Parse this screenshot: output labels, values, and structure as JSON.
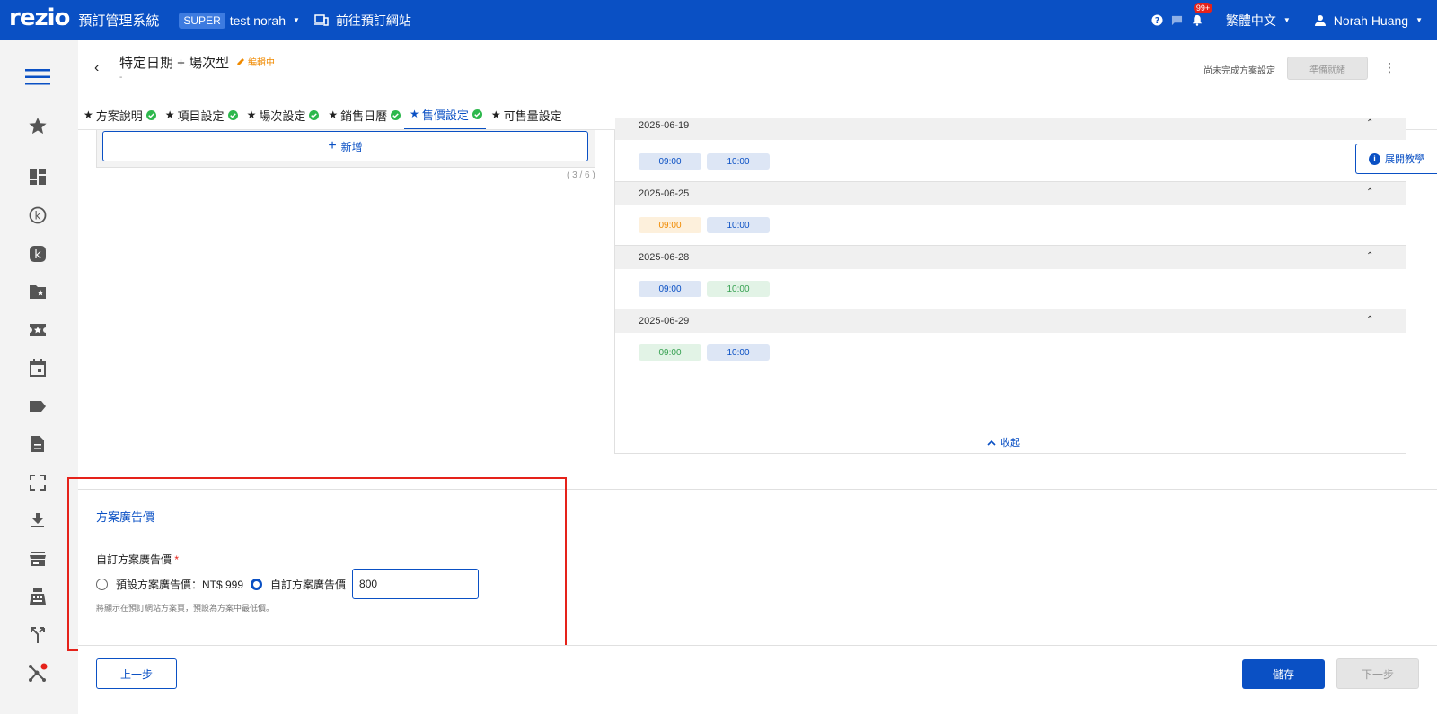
{
  "topbar": {
    "logo": "rezio",
    "system_title": "預訂管理系統",
    "super_badge": "SUPER",
    "account_name": "test norah",
    "goto_site": "前往預訂網站",
    "notification_count": "99+",
    "language": "繁體中文",
    "user_name": "Norah Huang",
    "icons": [
      "help-icon",
      "chat-icon",
      "bell-icon",
      "person-icon"
    ]
  },
  "sidebar": {
    "items": [
      "menu-icon",
      "star-icon",
      "dashboard-icon",
      "k-circle-icon",
      "k-square-icon",
      "folder-star-icon",
      "ticket-icon",
      "calendar-icon",
      "label-icon",
      "document-icon",
      "fullscreen-icon",
      "download-icon",
      "store-icon",
      "cashier-icon",
      "merge-icon",
      "network-icon"
    ]
  },
  "header": {
    "back_icon": "‹",
    "title": "特定日期 + 場次型",
    "editing_status": "編輯中",
    "subtitle": "-",
    "incomplete_text": "尚未完成方案設定",
    "ready_button": "準備就緒",
    "more_icon": "⋮"
  },
  "tabs": [
    {
      "label": "方案說明",
      "done": true
    },
    {
      "label": "項目設定",
      "done": true
    },
    {
      "label": "場次設定",
      "done": true
    },
    {
      "label": "銷售日曆",
      "done": true
    },
    {
      "label": "售價設定",
      "done": true,
      "active": true
    },
    {
      "label": "可售量設定",
      "done": false
    }
  ],
  "left_panel": {
    "add_button": "新增",
    "count": "( 3 / 6 )"
  },
  "schedule": {
    "partial_date": "2025-06-19",
    "dates": [
      {
        "date": "2025-06-19",
        "slots": [
          {
            "time": "09:00",
            "color": "blue"
          },
          {
            "time": "10:00",
            "color": "blue"
          }
        ]
      },
      {
        "date": "2025-06-25",
        "slots": [
          {
            "time": "09:00",
            "color": "orange"
          },
          {
            "time": "10:00",
            "color": "blue"
          }
        ]
      },
      {
        "date": "2025-06-28",
        "slots": [
          {
            "time": "09:00",
            "color": "blue"
          },
          {
            "time": "10:00",
            "color": "green"
          }
        ]
      },
      {
        "date": "2025-06-29",
        "slots": [
          {
            "time": "09:00",
            "color": "green"
          },
          {
            "time": "10:00",
            "color": "blue"
          }
        ]
      }
    ],
    "collapse_label": "收起"
  },
  "tutorial_button": "展開教學",
  "ad_price": {
    "section_title": "方案廣告價",
    "field_label": "自訂方案廣告價",
    "required_mark": "*",
    "option_default": "預設方案廣告價：NT$ 999",
    "option_custom": "自訂方案廣告價",
    "custom_value": "800",
    "hint": "將顯示在預訂網站方案頁，預設為方案中最低價。"
  },
  "footer": {
    "prev_button": "上一步",
    "save_button": "儲存",
    "next_button": "下一步"
  },
  "colors": {
    "brand": "#0a50c4",
    "editing": "#f08a00",
    "done_check": "#2db84d",
    "highlight_box": "#e5221a"
  }
}
